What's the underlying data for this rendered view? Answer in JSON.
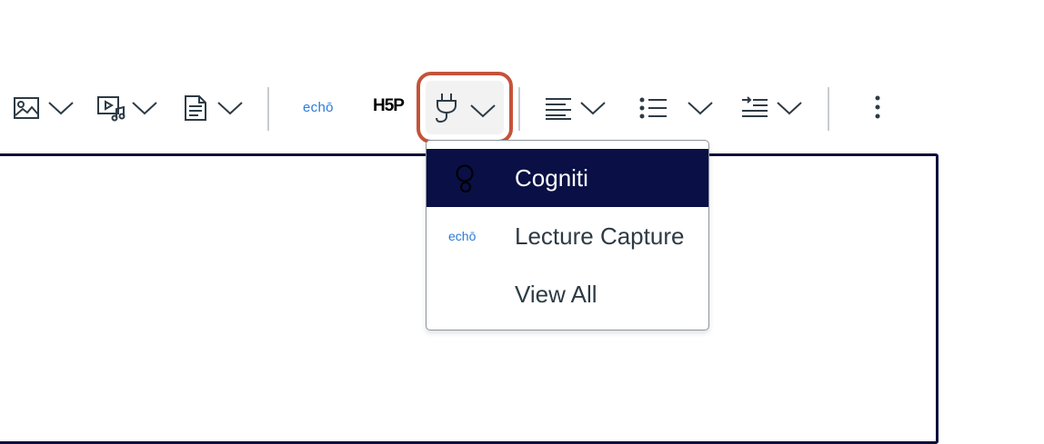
{
  "toolbar": {
    "image_button": {
      "icon": "image-icon",
      "dropdown_icon": "chevron-down-icon"
    },
    "media_button": {
      "icon": "media-icon",
      "dropdown_icon": "chevron-down-icon"
    },
    "document_button": {
      "icon": "document-icon",
      "dropdown_icon": "chevron-down-icon"
    },
    "echo_label": "echō",
    "h5p_label": "H5P",
    "apps_button": {
      "icon": "plug-icon",
      "dropdown_icon": "chevron-down-icon",
      "focus_color": "#c4533b"
    },
    "align_button": {
      "icon": "align-left-icon",
      "dropdown_icon": "chevron-down-icon"
    },
    "list_button": {
      "icon": "bullet-list-icon",
      "dropdown_icon": "chevron-down-icon"
    },
    "indent_button": {
      "icon": "indent-icon",
      "dropdown_icon": "chevron-down-icon"
    },
    "more_button": {
      "icon": "more-vertical-icon"
    }
  },
  "apps_menu": {
    "items": [
      {
        "label": "Cogniti",
        "icon": "cogniti-icon",
        "active": true
      },
      {
        "label": "Lecture Capture",
        "icon_text": "echō",
        "active": false
      },
      {
        "label": "View All",
        "active": false
      }
    ],
    "active_bg": "#0a0f45"
  },
  "colors": {
    "editor_border": "#0a0f3c",
    "echo_blue": "#2b7bd9"
  }
}
